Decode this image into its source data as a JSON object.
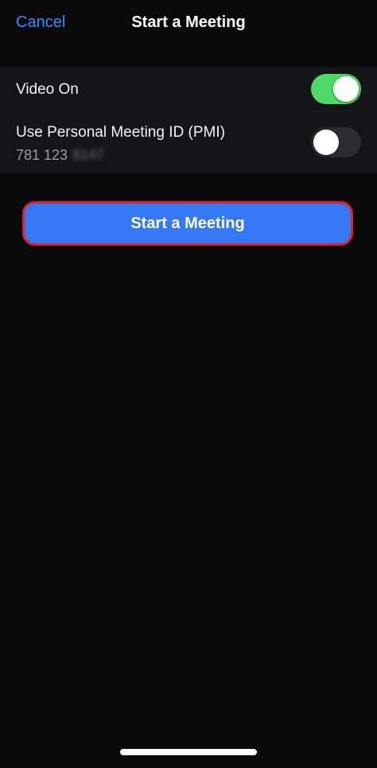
{
  "nav": {
    "cancel_label": "Cancel",
    "title": "Start a Meeting"
  },
  "settings": {
    "video": {
      "label": "Video On",
      "enabled": true
    },
    "pmi": {
      "label": "Use Personal Meeting ID (PMI)",
      "id_visible": "781 123",
      "id_obscured": "8147",
      "enabled": false
    }
  },
  "start_button": {
    "label": "Start a Meeting"
  },
  "colors": {
    "background": "#0a0a0b",
    "accent_link": "#3a8cff",
    "button_fill": "#3478f6",
    "button_outline": "#e3202a",
    "toggle_on": "#4cd964",
    "toggle_off": "#2c2d31"
  }
}
